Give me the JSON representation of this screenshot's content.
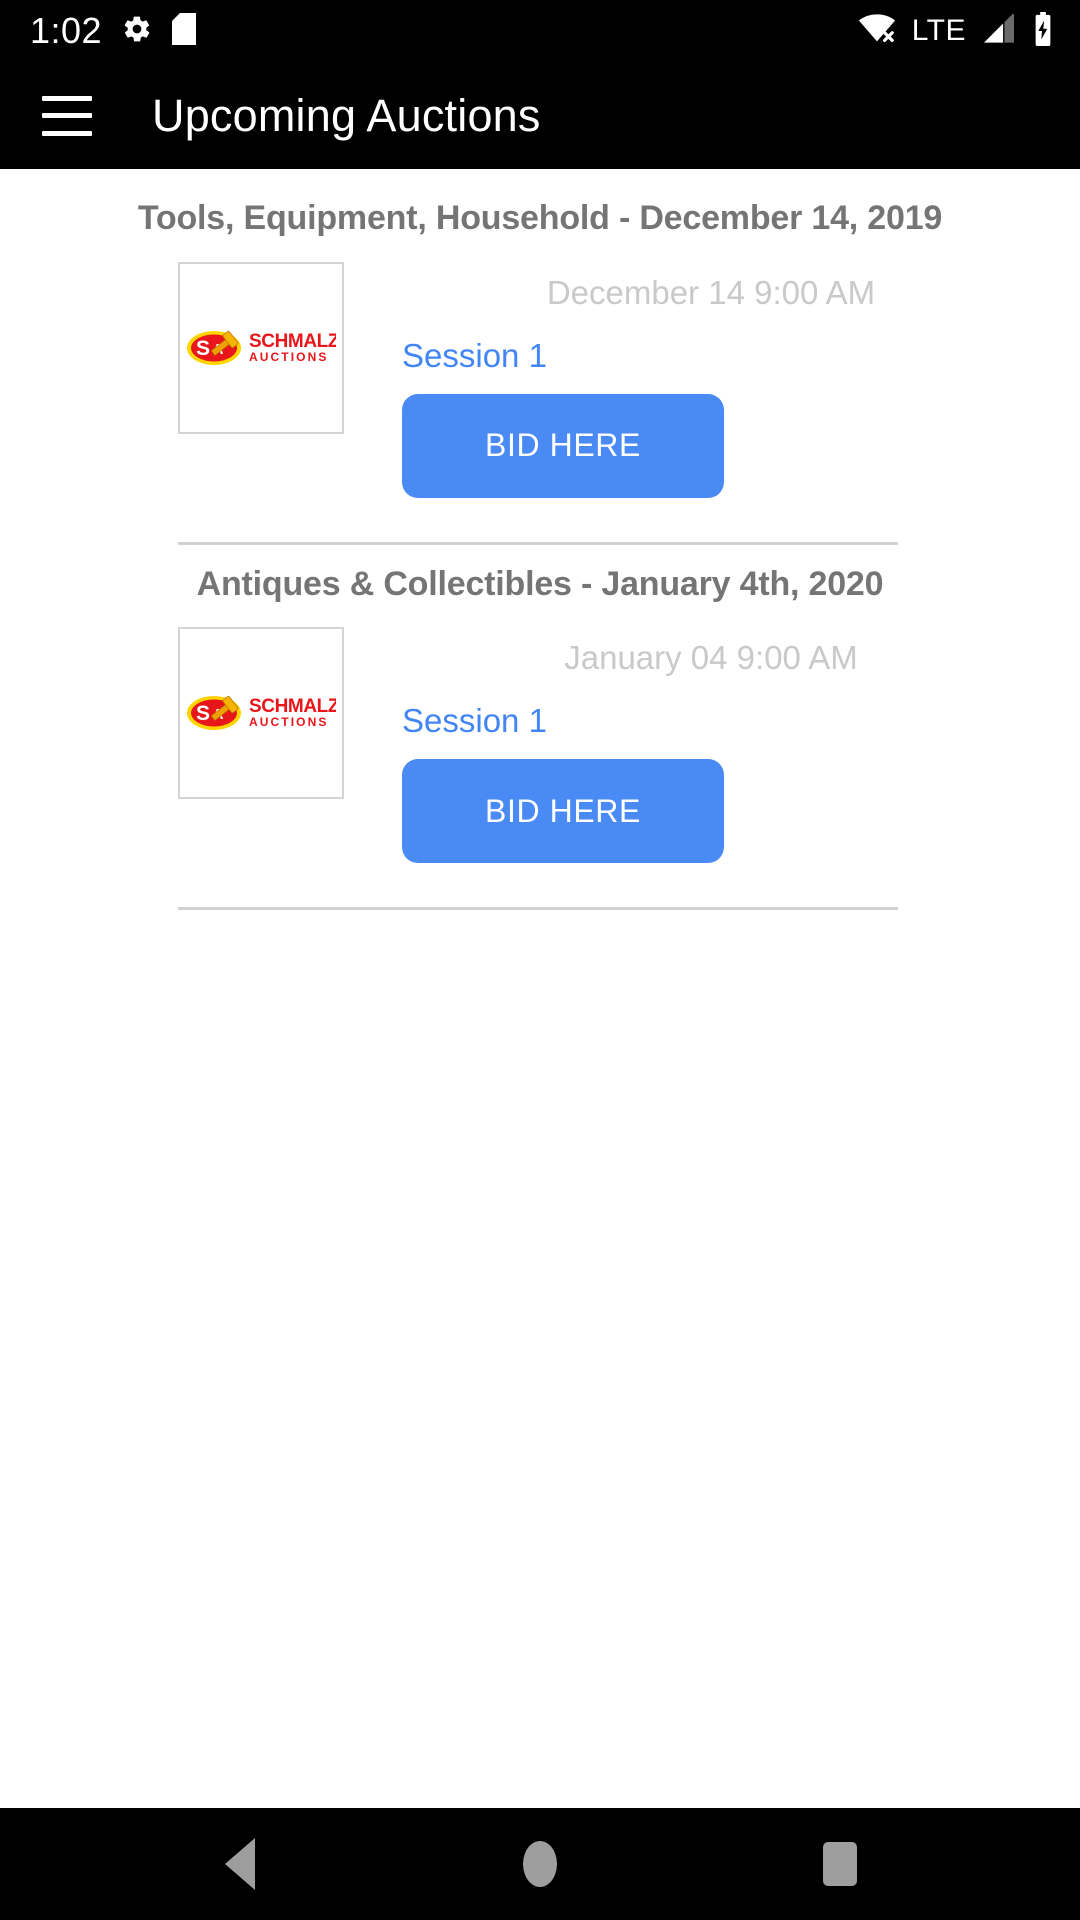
{
  "status_bar": {
    "clock": "1:02",
    "network_label": "LTE",
    "icons": {
      "gear": "gear-icon",
      "sd_card": "sd-card-icon",
      "wifi_off": "wifi-off-icon",
      "signal": "cellular-signal-icon",
      "battery": "battery-charging-icon"
    }
  },
  "app_bar": {
    "menu_icon": "hamburger-menu-icon",
    "title": "Upcoming Auctions"
  },
  "auctions": [
    {
      "title": "Tools, Equipment, Household - December 14, 2019",
      "date": "December 14 9:00 AM",
      "session": "Session 1",
      "bid_label": "BID HERE",
      "logo_alt": "Schmalz Auctions"
    },
    {
      "title": "Antiques & Collectibles - January 4th, 2020",
      "date": "January 04 9:00 AM",
      "session": "Session 1",
      "bid_label": "BID HERE",
      "logo_alt": "Schmalz Auctions"
    }
  ],
  "nav_bar": {
    "back": "back-nav-icon",
    "home": "home-nav-icon",
    "recents": "recents-nav-icon"
  },
  "colors": {
    "accent_blue": "#4285f4",
    "button_blue": "#4a8af4",
    "title_gray": "#757575",
    "date_gray": "#c9c9c9",
    "divider_gray": "#d2d2d2",
    "bar_black": "#000000",
    "logo_red": "#e8151a",
    "logo_yellow": "#ffd400"
  }
}
